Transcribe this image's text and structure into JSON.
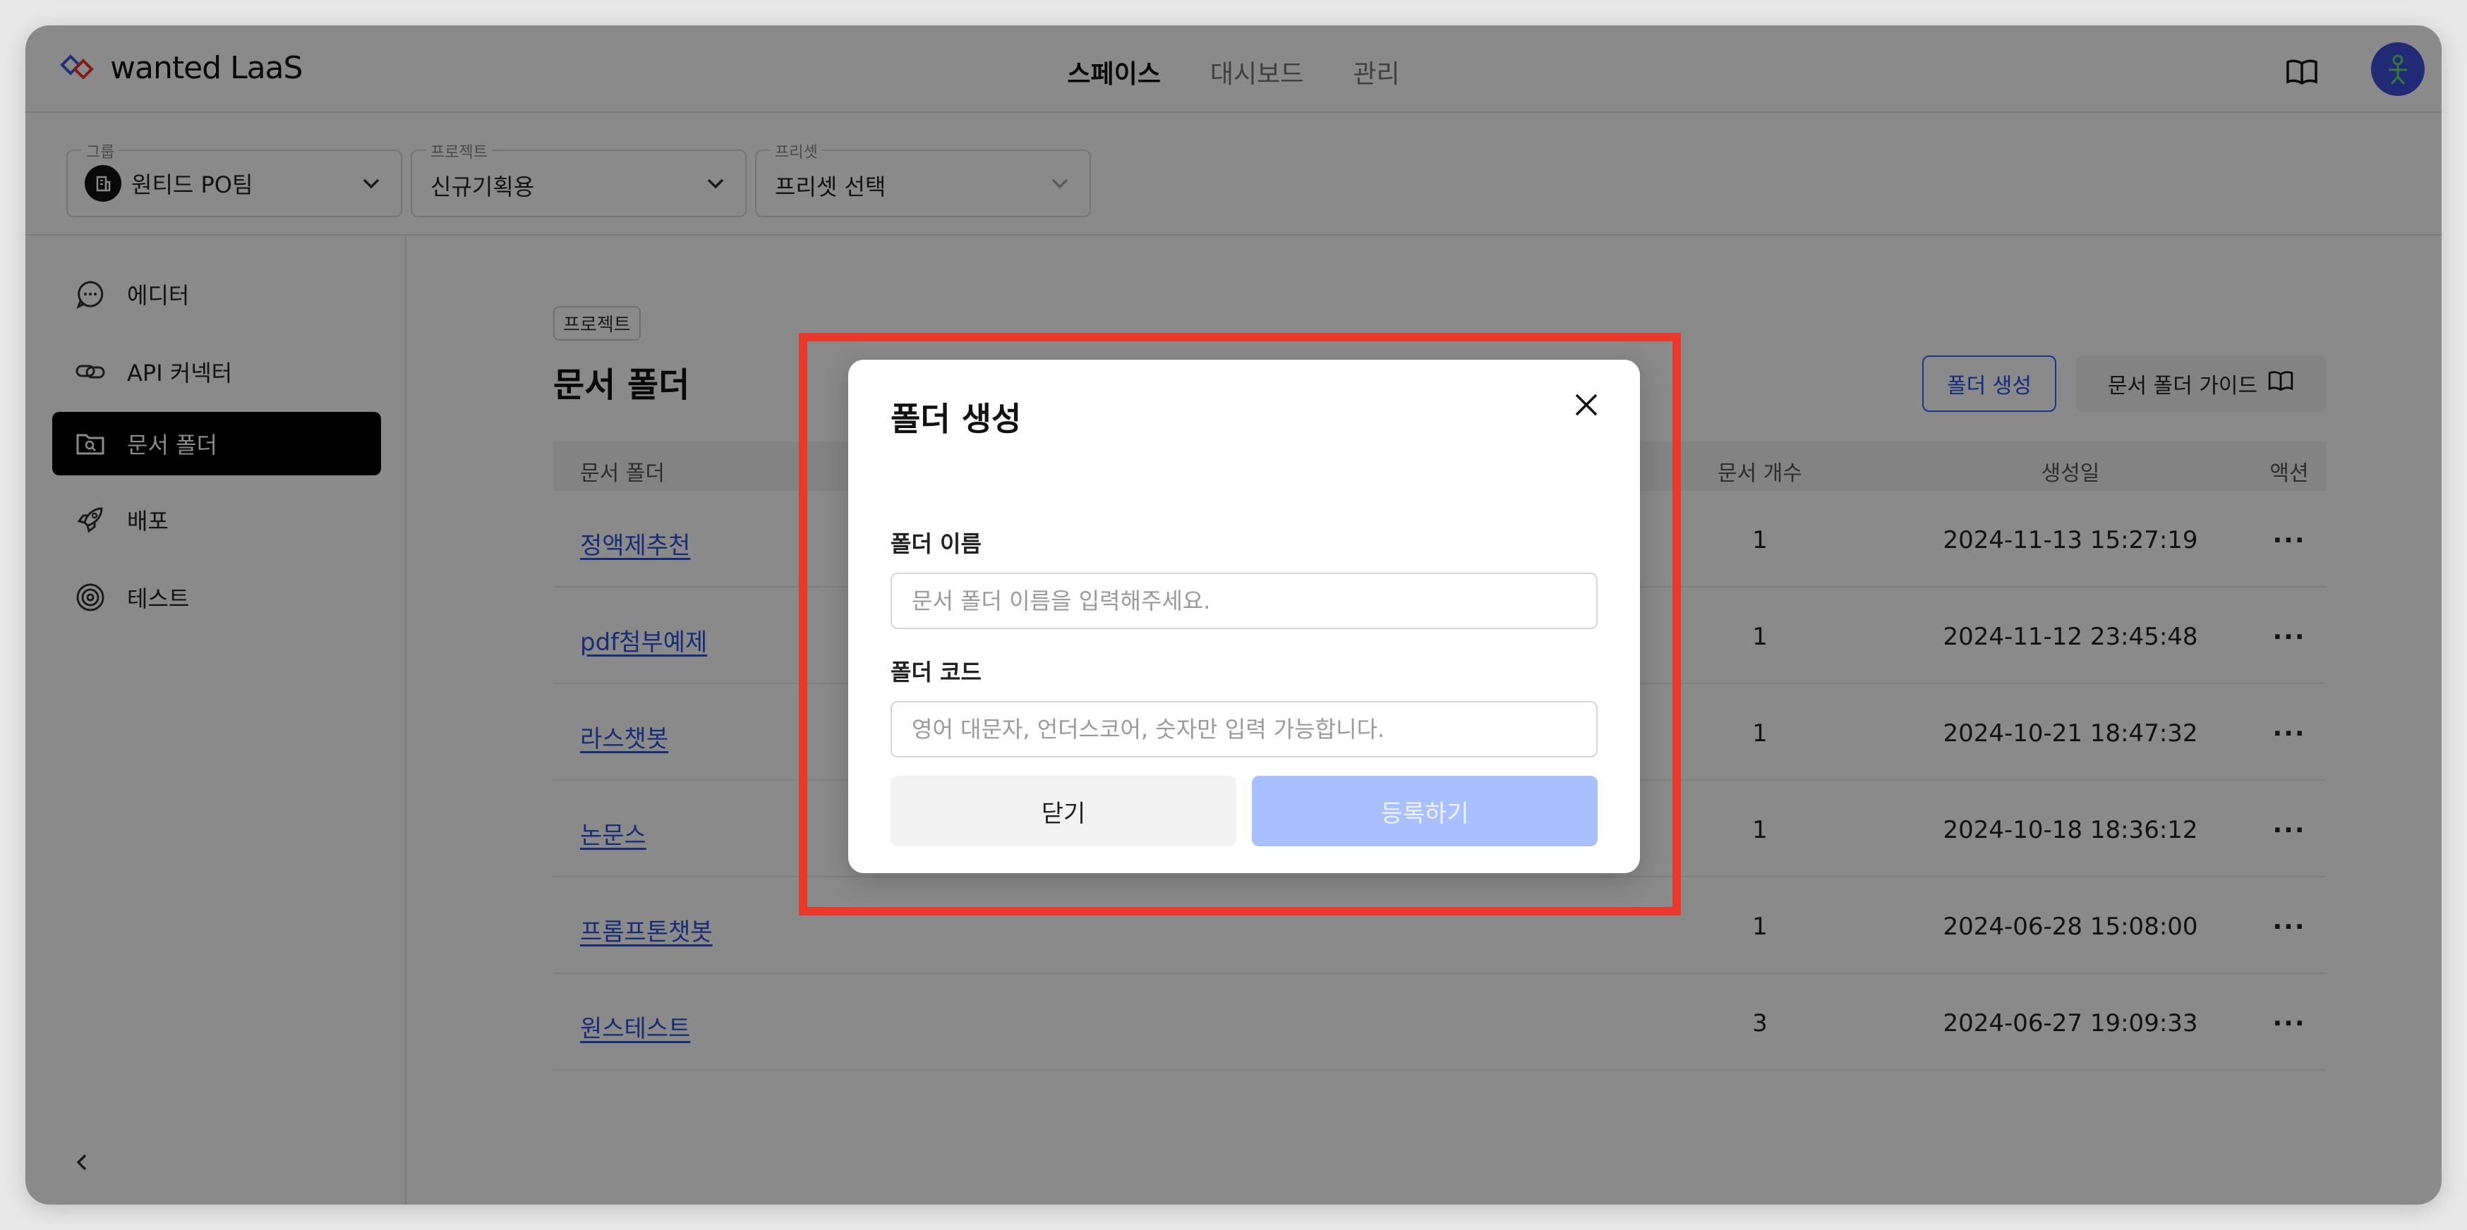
{
  "app": {
    "logo_text": "wanted LaaS",
    "nav": [
      {
        "label": "스페이스",
        "active": true
      },
      {
        "label": "대시보드",
        "active": false
      },
      {
        "label": "관리",
        "active": false
      }
    ]
  },
  "selectors": {
    "group": {
      "label": "그룹",
      "value": "원티드 PO팀"
    },
    "project": {
      "label": "프로젝트",
      "value": "신규기획용"
    },
    "preset": {
      "label": "프리셋",
      "value": "프리셋 선택"
    }
  },
  "sidebar": {
    "items": [
      {
        "label": "에디터",
        "icon": "chat-bubble-icon",
        "active": false
      },
      {
        "label": "API 커넥터",
        "icon": "link-icon",
        "active": false
      },
      {
        "label": "문서 폴더",
        "icon": "folder-search-icon",
        "active": true
      },
      {
        "label": "배포",
        "icon": "rocket-icon",
        "active": false
      },
      {
        "label": "테스트",
        "icon": "target-icon",
        "active": false
      }
    ]
  },
  "main": {
    "breadcrumb": "프로젝트",
    "title": "문서 폴더",
    "create_button": "폴더 생성",
    "guide_button": "문서 폴더 가이드",
    "table": {
      "headers": {
        "name": "문서 폴더",
        "count": "문서 개수",
        "created": "생성일",
        "action": "액션"
      },
      "rows": [
        {
          "name": "정액제추천",
          "count": "1",
          "created": "2024-11-13 15:27:19",
          "action": "···"
        },
        {
          "name": "pdf첨부예제",
          "count": "1",
          "created": "2024-11-12 23:45:48",
          "action": "···"
        },
        {
          "name": "라스챗봇",
          "count": "1",
          "created": "2024-10-21 18:47:32",
          "action": "···"
        },
        {
          "name": "논문스",
          "count": "1",
          "created": "2024-10-18 18:36:12",
          "action": "···"
        },
        {
          "name": "프롬프톤챗봇",
          "count": "1",
          "created": "2024-06-28 15:08:00",
          "action": "···"
        },
        {
          "name": "원스테스트",
          "count": "3",
          "created": "2024-06-27 19:09:33",
          "action": "···"
        }
      ]
    }
  },
  "modal": {
    "title": "폴더 생성",
    "name_label": "폴더 이름",
    "name_placeholder": "문서 폴더 이름을 입력해주세요.",
    "code_label": "폴더 코드",
    "code_placeholder": "영어 대문자, 언더스코어, 숫자만 입력 가능합니다.",
    "close_button": "닫기",
    "submit_button": "등록하기"
  },
  "colors": {
    "accent": "#2254e6",
    "highlight_border": "#e8392c",
    "submit_disabled": "#a8c0ff"
  }
}
